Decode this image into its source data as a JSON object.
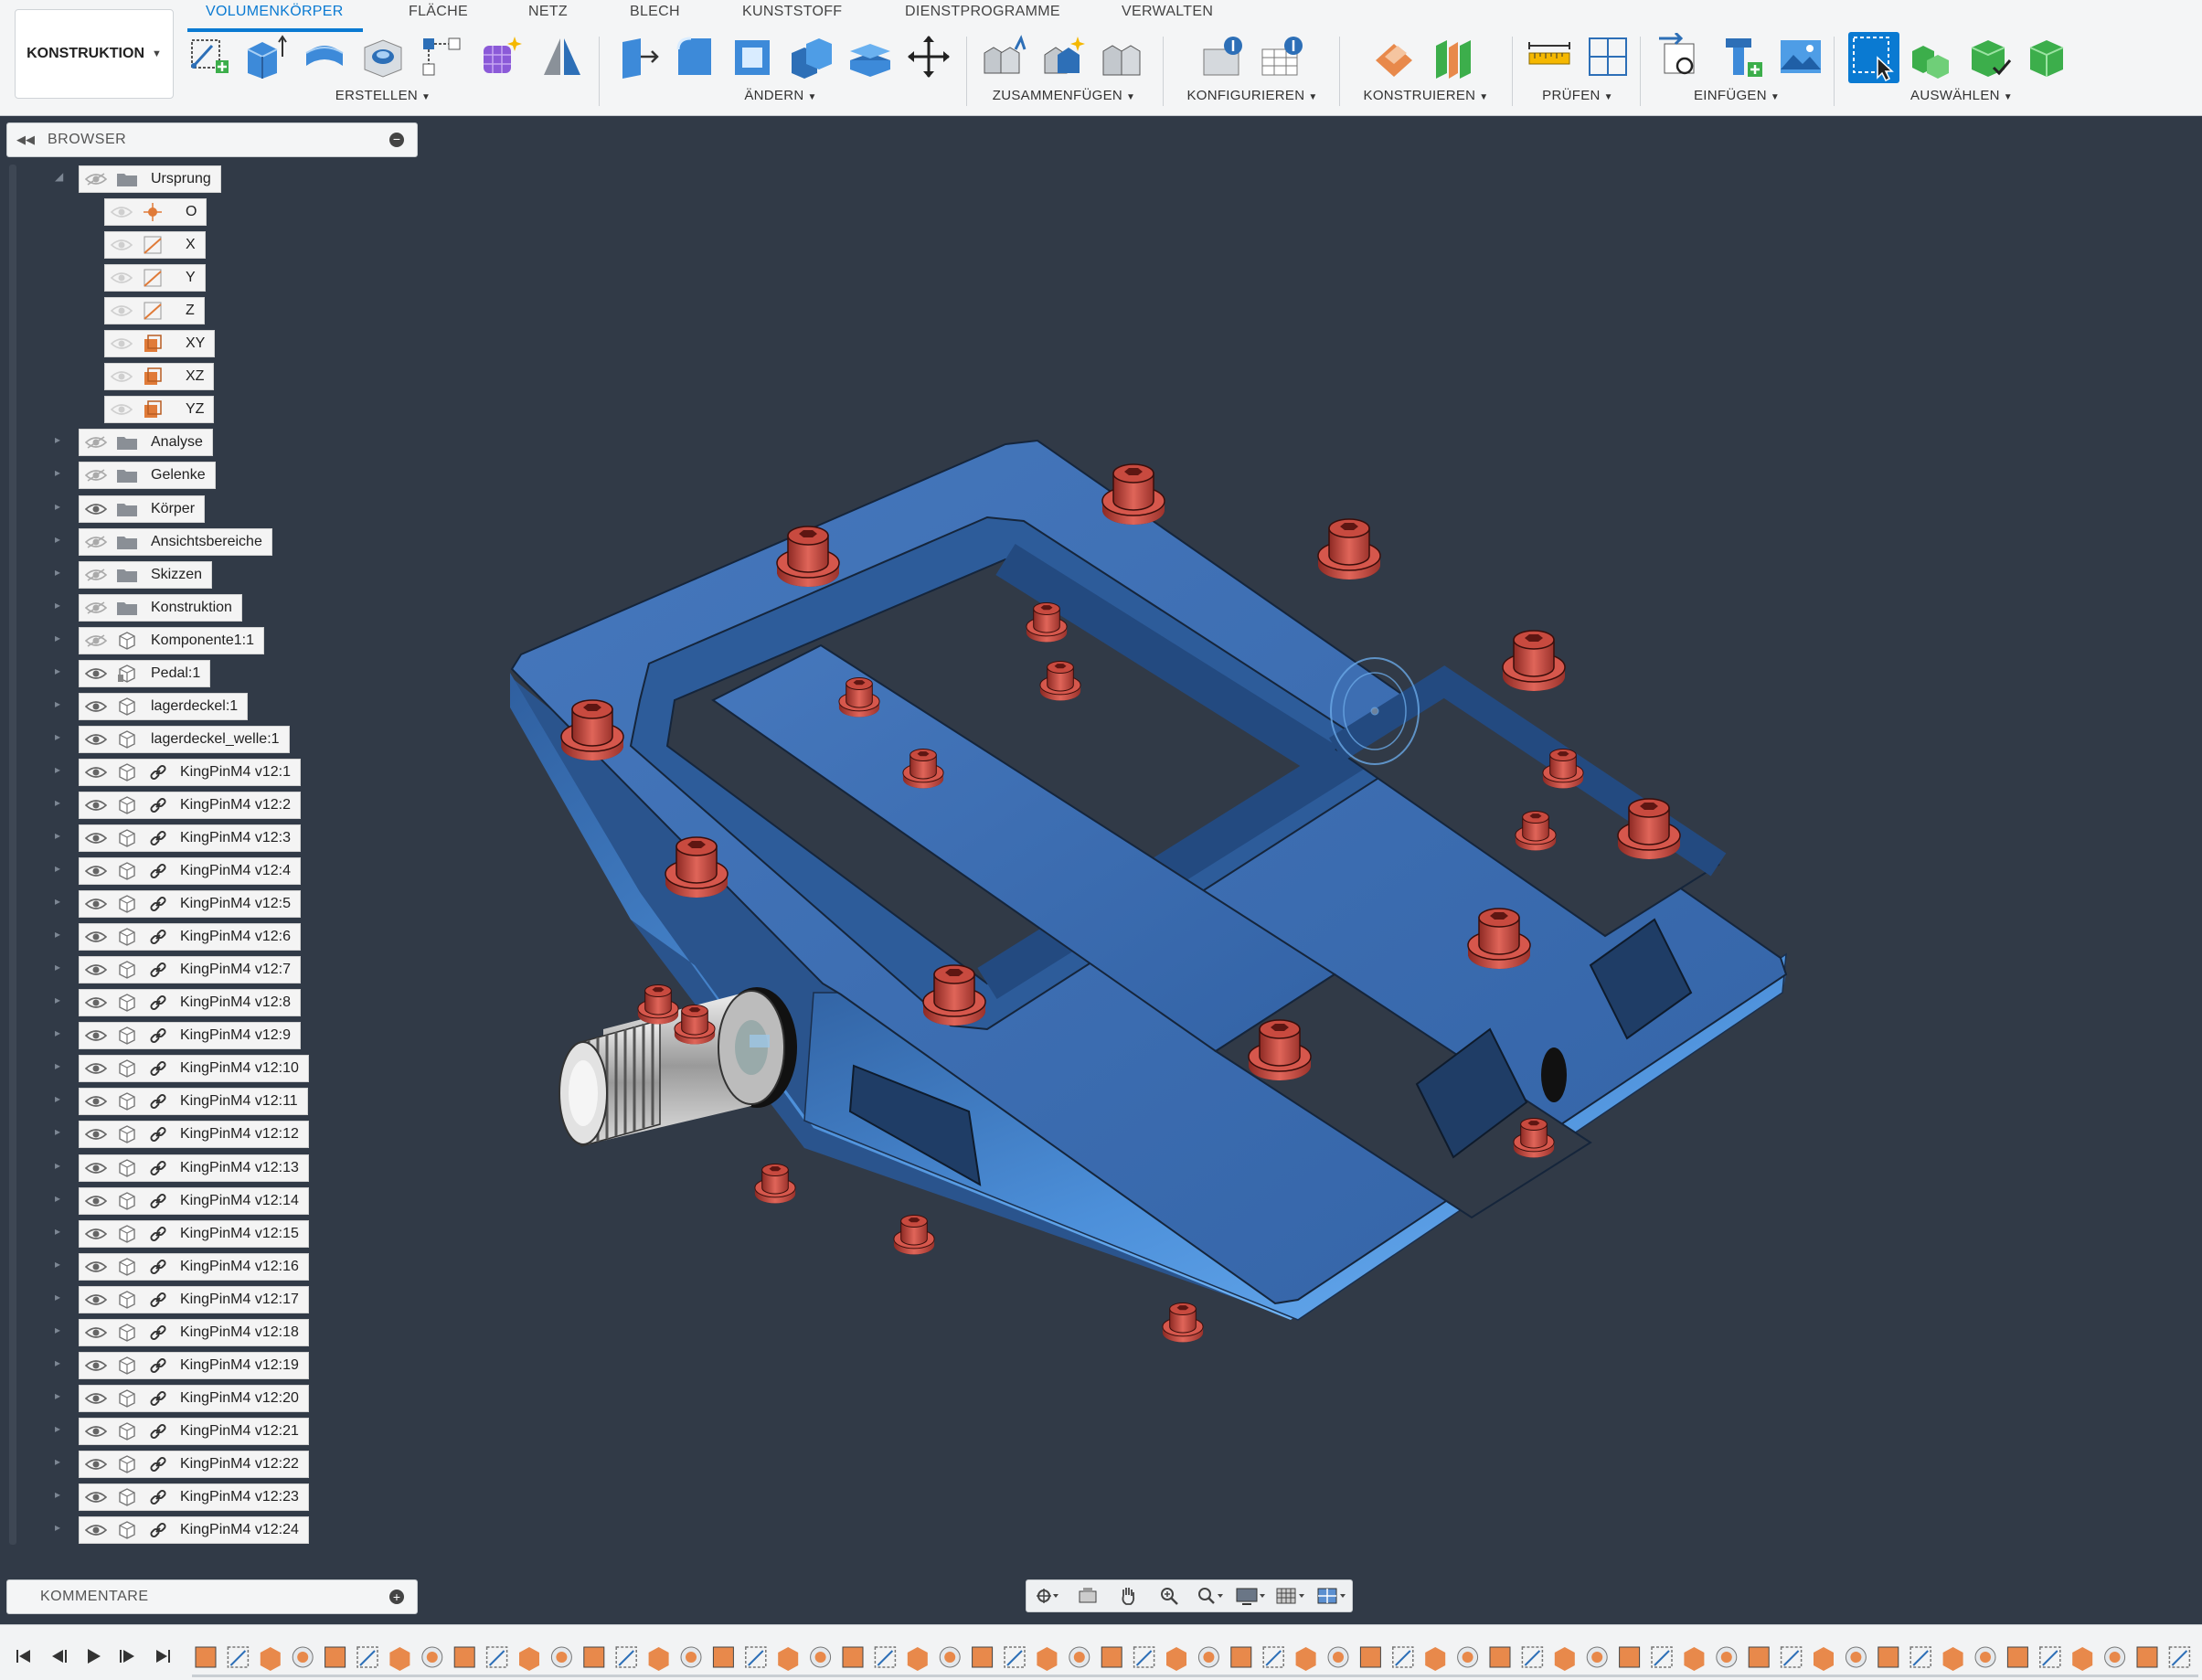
{
  "workspace": {
    "label": "KONSTRUKTION"
  },
  "tabs": [
    "VOLUMENKÖRPER",
    "FLÄCHE",
    "NETZ",
    "BLECH",
    "KUNSTSTOFF",
    "DIENSTPROGRAMME",
    "VERWALTEN"
  ],
  "active_tab": "VOLUMENKÖRPER",
  "groups": [
    "ERSTELLEN",
    "ÄNDERN",
    "ZUSAMMENFÜGEN",
    "KONFIGURIEREN",
    "KONSTRUIEREN",
    "PRÜFEN",
    "EINFÜGEN",
    "AUSWÄHLEN"
  ],
  "browser": {
    "title": "BROWSER",
    "origin": {
      "label": "Ursprung",
      "children": [
        "O",
        "X",
        "Y",
        "Z",
        "XY",
        "XZ",
        "YZ"
      ]
    },
    "folders": [
      "Analyse",
      "Gelenke",
      "Körper",
      "Ansichtsbereiche",
      "Skizzen",
      "Konstruktion"
    ],
    "components": [
      "Komponente1:1",
      "Pedal:1",
      "lagerdeckel:1",
      "lagerdeckel_welle:1"
    ],
    "linked": [
      "KingPinM4 v12:1",
      "KingPinM4 v12:2",
      "KingPinM4 v12:3",
      "KingPinM4 v12:4",
      "KingPinM4 v12:5",
      "KingPinM4 v12:6",
      "KingPinM4 v12:7",
      "KingPinM4 v12:8",
      "KingPinM4 v12:9",
      "KingPinM4 v12:10",
      "KingPinM4 v12:11",
      "KingPinM4 v12:12",
      "KingPinM4 v12:13",
      "KingPinM4 v12:14",
      "KingPinM4 v12:15",
      "KingPinM4 v12:16",
      "KingPinM4 v12:17",
      "KingPinM4 v12:18",
      "KingPinM4 v12:19",
      "KingPinM4 v12:20",
      "KingPinM4 v12:21",
      "KingPinM4 v12:22",
      "KingPinM4 v12:23",
      "KingPinM4 v12:24"
    ]
  },
  "comments": {
    "title": "KOMMENTARE"
  },
  "colors": {
    "accent": "#0a7ad2",
    "viewport_bg": "#313a47",
    "pedal_body": "#3a6fb4",
    "pins": "#c84a3f",
    "axle": "#c8c8c8"
  }
}
